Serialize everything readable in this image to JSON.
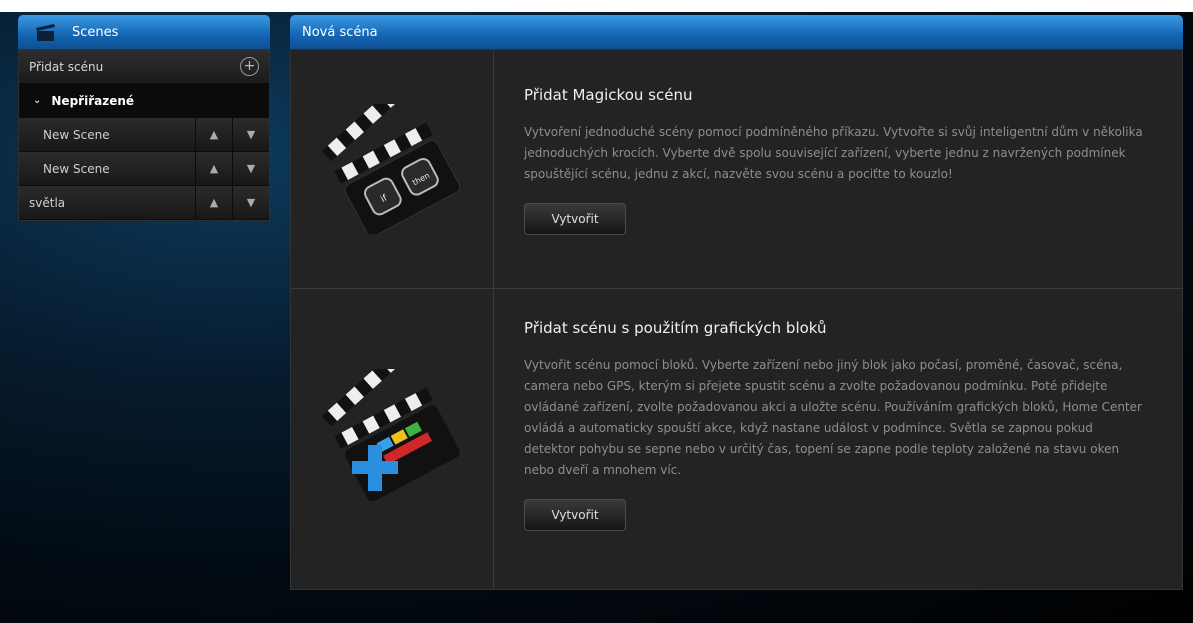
{
  "sidebar": {
    "header": "Scenes",
    "add_scene_label": "Přidat scénu",
    "group_label": "Nepřiřazené",
    "scenes": [
      {
        "label": "New Scene"
      },
      {
        "label": "New Scene"
      },
      {
        "label": "světla"
      }
    ]
  },
  "main": {
    "header": "Nová scéna",
    "options": [
      {
        "title": "Přidat Magickou scénu",
        "description": "Vytvoření jednoduché scény pomocí podmíněného příkazu. Vytvořte si svůj inteligentní dům v několika jednoduchých krocích. Vyberte dvě spolu související zařízení, vyberte jednu z navržených podmínek spouštějící scénu, jednu z akcí, nazvěte svou scénu a pociťte to kouzlo!",
        "button_label": "Vytvořit",
        "icon_text_if": "if",
        "icon_text_then": "then"
      },
      {
        "title": "Přidat scénu s použitím grafických bloků",
        "description": "Vytvořit scénu pomocí bloků. Vyberte zařízení nebo jiný blok jako počasí, proměné, časovač, scéna, camera nebo GPS, kterým si přejete spustit scénu a zvolte požadovanou podmínku. Poté přidejte ovládané zařízení, zvolte požadovanou akci a uložte scénu. Používáním grafických bloků, Home Center ovládá a automaticky spouští akce, když nastane událost v podmínce. Světla se zapnou pokud detektor pohybu se sepne nebo v určitý čas, topení se zapne podle teploty založené na stavu oken nebo dveří a mnohem víc.",
        "button_label": "Vytvořit"
      }
    ]
  }
}
